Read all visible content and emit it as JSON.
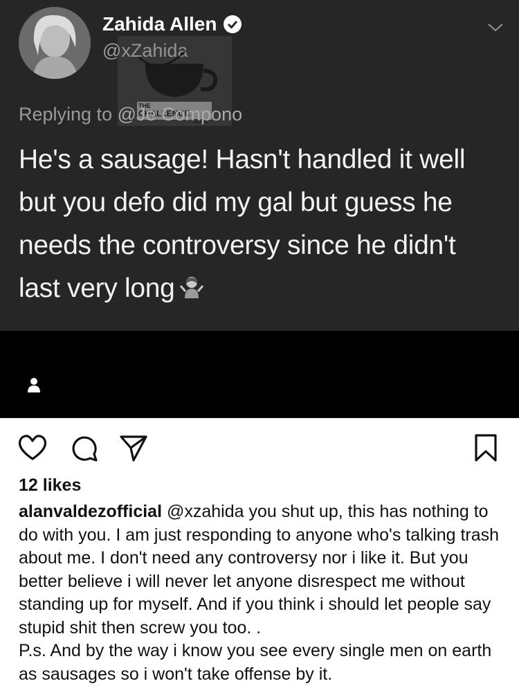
{
  "tweet": {
    "author_name": "Zahida Allen",
    "author_handle": "@xZahida",
    "reply_prefix": "Replying to",
    "reply_target": "@Je    Compono",
    "text": "He's a sausage! Hasn't handled it well but you defo did my gal but guess he needs the controversy since he didn't last very long",
    "emoji_icon": "person-shrugging-emoji"
  },
  "watermark": {
    "line1": "THE",
    "line2": "CHALLENGE",
    "line3": "TEAA"
  },
  "post": {
    "likes": "12 likes",
    "caption_username": "alanvaldezofficial",
    "caption_text": "@xzahida you shut up, this has nothing to do with you. I am just responding to anyone who's talking trash about me. I don't need any controversy nor i like it. But you better believe i will never let anyone disrespect me without standing up for myself. And if you think i should let people say stupid shit then screw you too. .",
    "caption_ps": "P.s. And by the way i know you see every single men on earth as sausages so i won't take offense by it."
  },
  "colors": {
    "tweet_bg": "#262626",
    "band_bg": "#000000",
    "page_bg": "#ffffff"
  }
}
